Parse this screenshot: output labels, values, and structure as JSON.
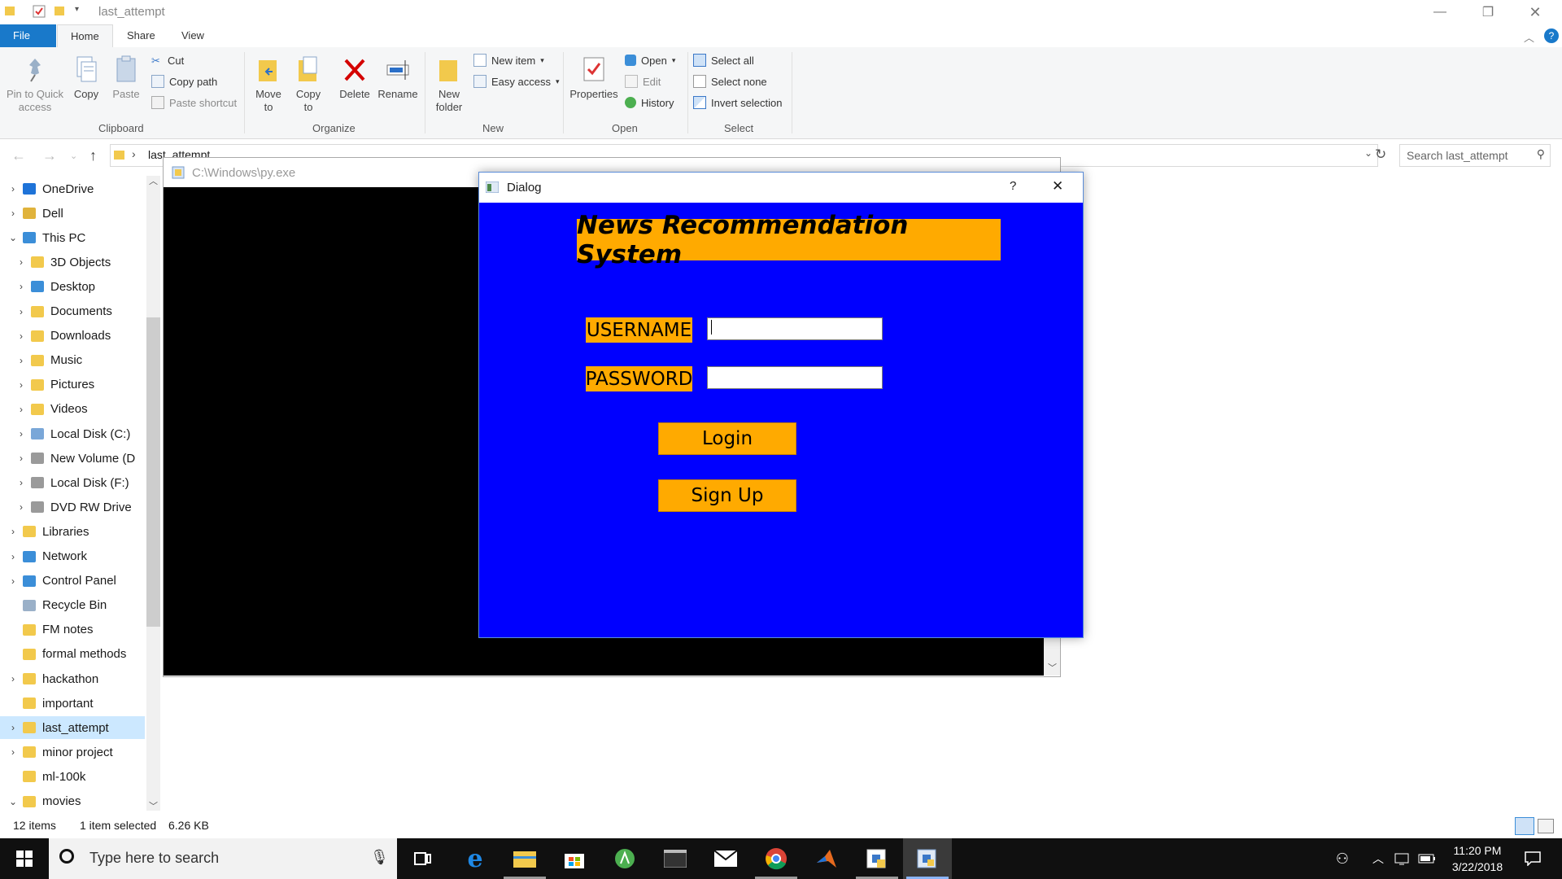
{
  "explorer": {
    "title": "last_attempt",
    "tabs": [
      {
        "label": "File"
      },
      {
        "label": "Home"
      },
      {
        "label": "Share"
      },
      {
        "label": "View"
      }
    ],
    "ribbon": {
      "clipboard": {
        "pin_label": "Pin to Quick access",
        "copy_label": "Copy",
        "paste_label": "Paste",
        "cut_label": "Cut",
        "copy_path_label": "Copy path",
        "paste_shortcut_label": "Paste shortcut",
        "group_label": "Clipboard"
      },
      "organize": {
        "move_to_label": "Move to",
        "copy_to_label": "Copy to",
        "delete_label": "Delete",
        "rename_label": "Rename",
        "group_label": "Organize"
      },
      "new": {
        "new_folder_label": "New folder",
        "new_item_label": "New item",
        "easy_access_label": "Easy access",
        "group_label": "New"
      },
      "open": {
        "properties_label": "Properties",
        "open_label": "Open",
        "edit_label": "Edit",
        "history_label": "History",
        "group_label": "Open"
      },
      "select": {
        "select_all_label": "Select all",
        "select_none_label": "Select none",
        "invert_label": "Invert selection",
        "group_label": "Select"
      }
    },
    "address": "last_attempt",
    "search_placeholder": "Search last_attempt",
    "nav_items": [
      {
        "label": "OneDrive",
        "expand": "›",
        "color": "#1e73d8"
      },
      {
        "label": "Dell",
        "expand": "›",
        "color": "#e0b33c"
      },
      {
        "label": "This PC",
        "expand": "⌄",
        "color": "#3b8ed8"
      },
      {
        "label": "3D Objects",
        "expand": "›",
        "color": "#f2c94c"
      },
      {
        "label": "Desktop",
        "expand": "›",
        "color": "#3b8ed8"
      },
      {
        "label": "Documents",
        "expand": "›",
        "color": "#f2c94c"
      },
      {
        "label": "Downloads",
        "expand": "›",
        "color": "#f2c94c"
      },
      {
        "label": "Music",
        "expand": "›",
        "color": "#f2c94c"
      },
      {
        "label": "Pictures",
        "expand": "›",
        "color": "#f2c94c"
      },
      {
        "label": "Videos",
        "expand": "›",
        "color": "#f2c94c"
      },
      {
        "label": "Local Disk (C:)",
        "expand": "›",
        "color": "#7aa7d8"
      },
      {
        "label": "New Volume (D",
        "expand": "›",
        "color": "#9a9a9a"
      },
      {
        "label": "Local Disk (F:)",
        "expand": "›",
        "color": "#9a9a9a"
      },
      {
        "label": "DVD RW Drive",
        "expand": "›",
        "color": "#9a9a9a"
      },
      {
        "label": "Libraries",
        "expand": "›",
        "color": "#f2c94c"
      },
      {
        "label": "Network",
        "expand": "›",
        "color": "#3b8ed8"
      },
      {
        "label": "Control Panel",
        "expand": "›",
        "color": "#3b8ed8"
      },
      {
        "label": "Recycle Bin",
        "expand": "",
        "color": "#9ab0c8"
      },
      {
        "label": "FM notes",
        "expand": "",
        "color": "#f2c94c"
      },
      {
        "label": "formal methods",
        "expand": "",
        "color": "#f2c94c"
      },
      {
        "label": "hackathon",
        "expand": "›",
        "color": "#f2c94c"
      },
      {
        "label": "important",
        "expand": "",
        "color": "#f2c94c"
      },
      {
        "label": "last_attempt",
        "expand": "›",
        "color": "#f2c94c"
      },
      {
        "label": "minor project",
        "expand": "›",
        "color": "#f2c94c"
      },
      {
        "label": "ml-100k",
        "expand": "",
        "color": "#f2c94c"
      },
      {
        "label": "movies",
        "expand": "⌄",
        "color": "#f2c94c"
      }
    ],
    "status": {
      "items_count": "12 items",
      "selection": "1 item selected",
      "size": "6.26 KB"
    }
  },
  "console": {
    "title": "C:\\Windows\\py.exe"
  },
  "dialog": {
    "title": "Dialog",
    "help": "?",
    "close": "✕",
    "heading": "News Recommendation System",
    "username_label": "USERNAME",
    "password_label": "PASSWORD",
    "username_value": "",
    "password_value": "",
    "login_label": "Login",
    "signup_label": "Sign Up"
  },
  "taskbar": {
    "search_placeholder": "Type here to search",
    "time": "11:20 PM",
    "date": "3/22/2018"
  }
}
